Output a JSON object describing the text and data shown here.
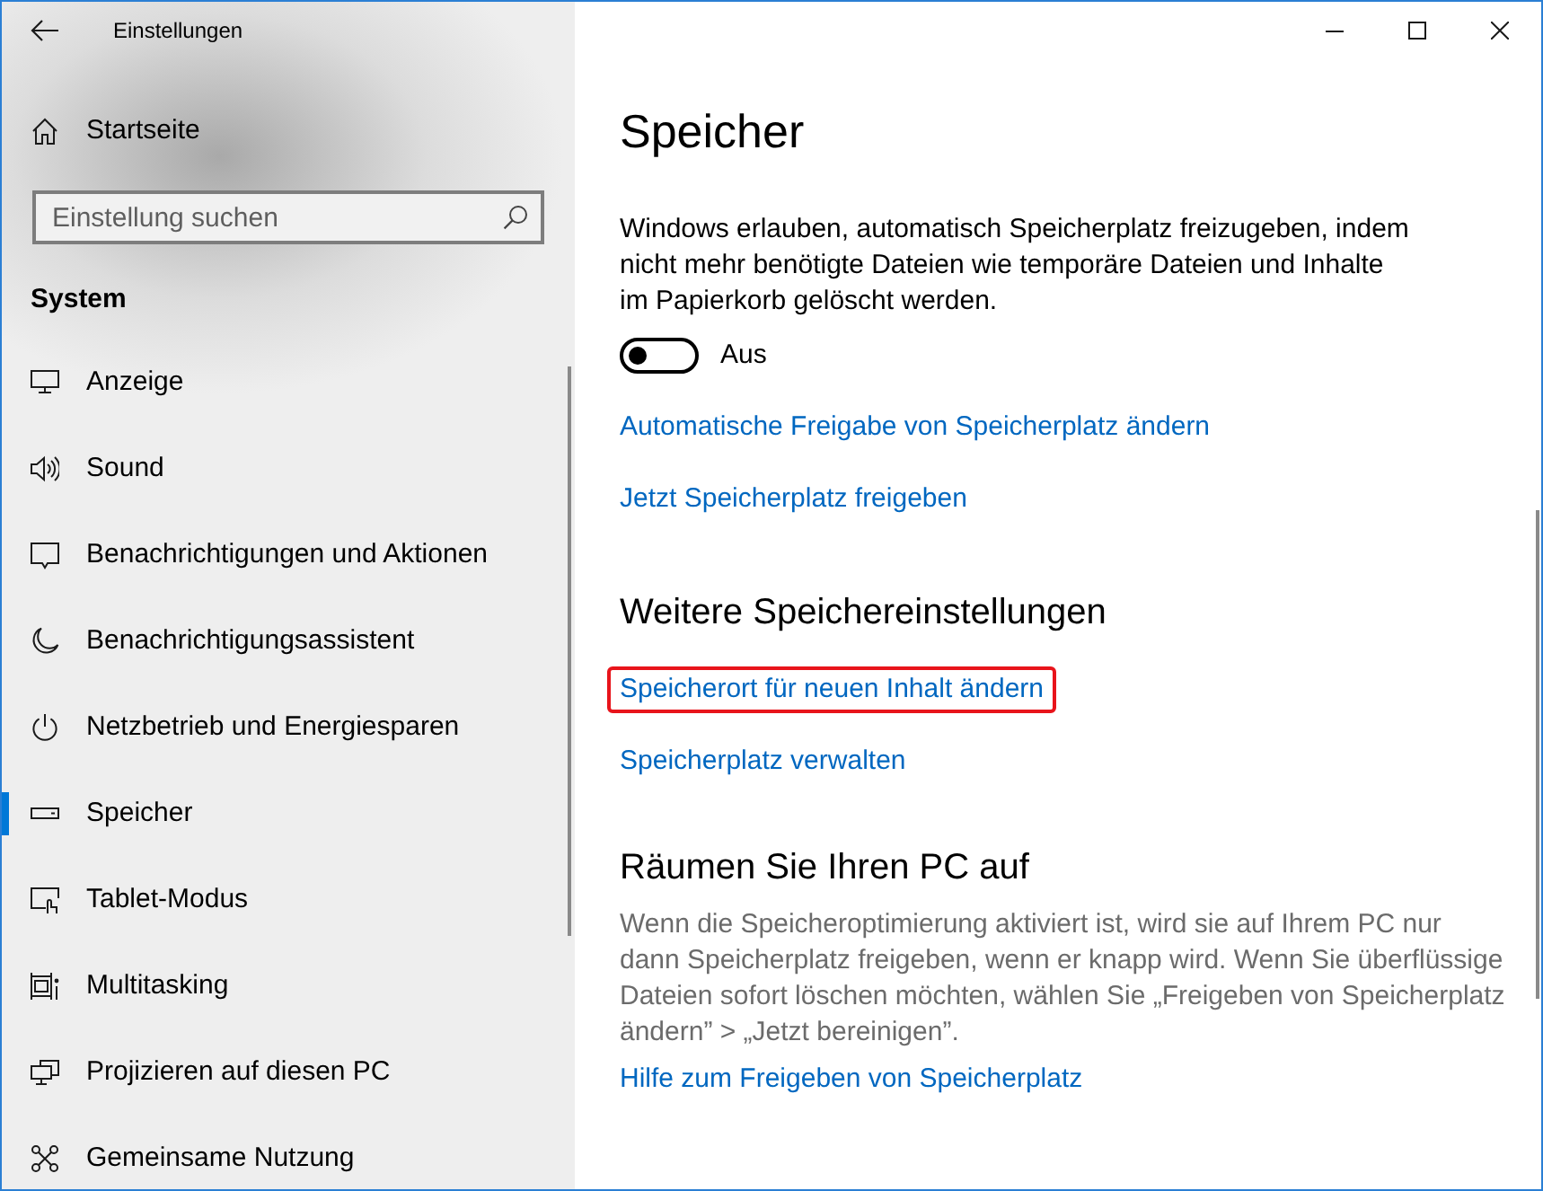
{
  "window": {
    "title": "Einstellungen"
  },
  "sidebar": {
    "home": "Startseite",
    "search": {
      "placeholder": "Einstellung suchen"
    },
    "section": "System",
    "items": [
      {
        "label": "Anzeige",
        "selected": false
      },
      {
        "label": "Sound",
        "selected": false
      },
      {
        "label": "Benachrichtigungen und Aktionen",
        "selected": false
      },
      {
        "label": "Benachrichtigungsassistent",
        "selected": false
      },
      {
        "label": "Netzbetrieb und Energiesparen",
        "selected": false
      },
      {
        "label": "Speicher",
        "selected": true
      },
      {
        "label": "Tablet-Modus",
        "selected": false
      },
      {
        "label": "Multitasking",
        "selected": false
      },
      {
        "label": "Projizieren auf diesen PC",
        "selected": false
      },
      {
        "label": "Gemeinsame Nutzung",
        "selected": false
      }
    ]
  },
  "main": {
    "title": "Speicher",
    "description": "Windows erlauben, automatisch Speicherplatz freizugeben, indem nicht mehr benötigte Dateien wie temporäre Dateien und Inhalte im Papierkorb gelöscht werden.",
    "toggle": {
      "on": false,
      "label": "Aus"
    },
    "links": [
      {
        "label": "Automatische Freigabe von Speicherplatz ändern",
        "highlighted": false
      },
      {
        "label": "Jetzt Speicherplatz freigeben",
        "highlighted": false
      }
    ],
    "sections": [
      {
        "heading": "Weitere Speichereinstellungen",
        "links": [
          {
            "label": "Speicherort für neuen Inhalt ändern",
            "highlighted": true
          },
          {
            "label": "Speicherplatz verwalten",
            "highlighted": false
          }
        ]
      },
      {
        "heading": "Räumen Sie Ihren PC auf",
        "description": "Wenn die Speicheroptimierung aktiviert ist, wird sie auf Ihrem PC nur dann Speicherplatz freigeben, wenn er knapp wird. Wenn Sie überflüssige Dateien sofort löschen möchten, wählen Sie „Freigeben von Speicherplatz ändern” > „Jetzt bereinigen”.",
        "links": [
          {
            "label": "Hilfe zum Freigeben von Speicherplatz",
            "highlighted": false
          }
        ]
      }
    ]
  }
}
